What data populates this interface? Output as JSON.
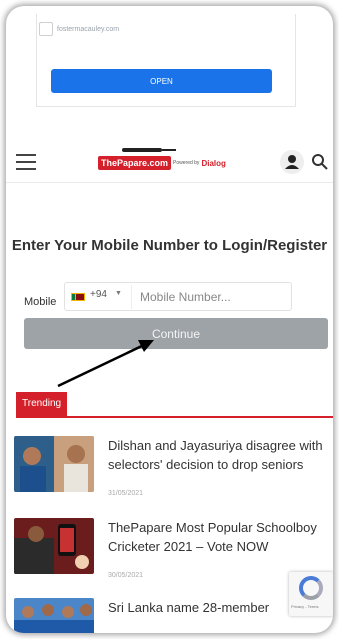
{
  "ad": {
    "url": "fostermacauley.com",
    "open_label": "OPEN"
  },
  "header": {
    "logo_main": "ThePapare.com",
    "logo_powered": "Powered by",
    "logo_partner": "Dialog"
  },
  "login": {
    "title": "Enter Your Mobile Number to Login/Register",
    "mobile_label": "Mobile",
    "dial_code": "+94",
    "mobile_placeholder": "Mobile Number...",
    "continue_label": "Continue"
  },
  "trending": {
    "tab_label": "Trending",
    "items": [
      {
        "headline": "Dilshan and Jayasuriya disagree with selectors' decision to drop seniors",
        "date": "31/05/2021"
      },
      {
        "headline": "ThePapare Most Popular Schoolboy Cricketer 2021 – Vote NOW",
        "date": "30/05/2021"
      },
      {
        "headline": "Sri Lanka name 28-member",
        "date": ""
      }
    ]
  },
  "recaptcha": {
    "text": "Privacy - Terms"
  }
}
